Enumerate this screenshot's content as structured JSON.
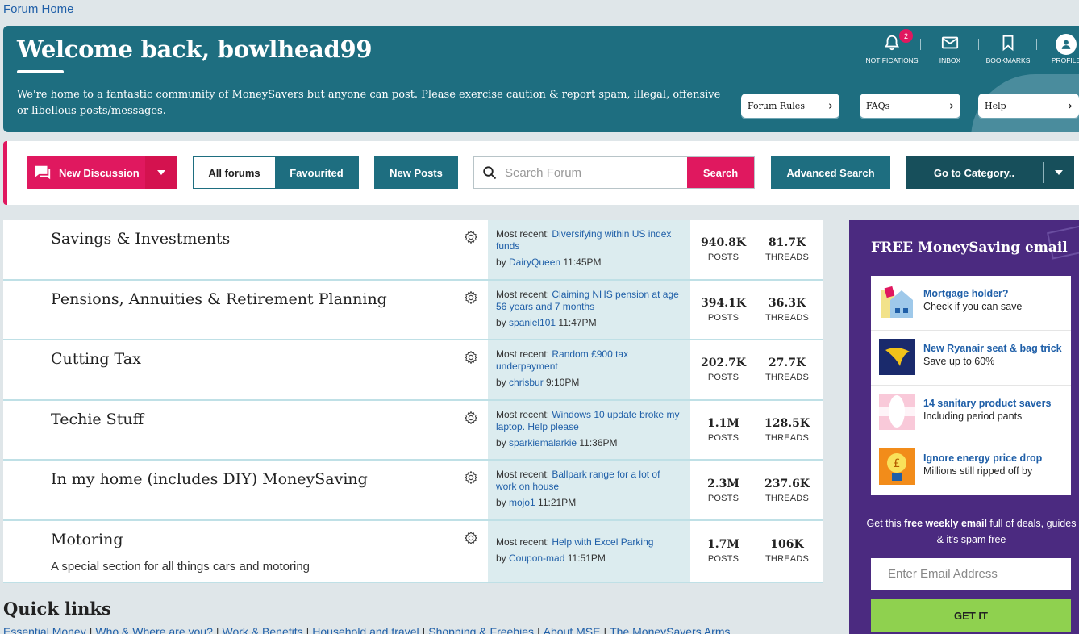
{
  "breadcrumb": "Forum Home",
  "hero": {
    "title": "Welcome back, bowlhead99",
    "intro": "We're home to a fantastic community of MoneySavers but anyone can post. Please exercise caution & report spam, illegal, offensive or libellous posts/messages.",
    "notifications_label": "NOTIFICATIONS",
    "notifications_count": "2",
    "inbox_label": "INBOX",
    "bookmarks_label": "BOOKMARKS",
    "profile_label": "PROFILE",
    "links": [
      "Forum Rules",
      "FAQs",
      "Help"
    ]
  },
  "toolbar": {
    "new_discussion": "New Discussion",
    "all_forums": "All forums",
    "favourited": "Favourited",
    "new_posts": "New Posts",
    "search_placeholder": "Search Forum",
    "search_button": "Search",
    "advanced_search": "Advanced Search",
    "go_to_category": "Go to Category.."
  },
  "forums": [
    {
      "title": "Savings & Investments",
      "desc": "",
      "recent_prefix": "Most recent: ",
      "recent_title": "Diversifying within US index funds",
      "by": "by ",
      "author": "DairyQueen",
      "time": "11:45PM",
      "posts": "940.8K",
      "threads": "81.7K"
    },
    {
      "title": "Pensions, Annuities & Retirement Planning",
      "desc": "",
      "recent_prefix": "Most recent: ",
      "recent_title": "Claiming NHS pension at age 56 years and 7 months",
      "by": "by ",
      "author": "spaniel101",
      "time": "11:47PM",
      "posts": "394.1K",
      "threads": "36.3K"
    },
    {
      "title": "Cutting Tax",
      "desc": "",
      "recent_prefix": "Most recent: ",
      "recent_title": "Random £900 tax underpayment",
      "by": "by ",
      "author": "chrisbur",
      "time": "9:10PM",
      "posts": "202.7K",
      "threads": "27.7K"
    },
    {
      "title": "Techie Stuff",
      "desc": "",
      "recent_prefix": "Most recent: ",
      "recent_title": "Windows 10 update broke my laptop. Help please",
      "by": "by ",
      "author": "sparkiemalarkie",
      "time": "11:36PM",
      "posts": "1.1M",
      "threads": "128.5K"
    },
    {
      "title": "In my home (includes DIY) MoneySaving",
      "desc": "",
      "recent_prefix": "Most recent: ",
      "recent_title": "Ballpark range for a lot of work on house",
      "by": "by ",
      "author": "mojo1",
      "time": "11:21PM",
      "posts": "2.3M",
      "threads": "237.6K"
    },
    {
      "title": "Motoring",
      "desc": "A special section for all things cars and motoring",
      "recent_prefix": "Most recent: ",
      "recent_title": "Help with Excel Parking",
      "by": "by ",
      "author": "Coupon-mad",
      "time": "11:51PM",
      "posts": "1.7M",
      "threads": "106K"
    }
  ],
  "stat_labels": {
    "posts": "POSTS",
    "threads": "THREADS"
  },
  "quick_links": {
    "heading": "Quick links",
    "items": [
      "Essential Money",
      "Who & Where are you?",
      "Work & Benefits",
      "Household and travel",
      "Shopping & Freebies",
      "About MSE",
      "The MoneySavers Arms"
    ],
    "separator": "|"
  },
  "promo": {
    "heading": "FREE MoneySaving email",
    "items": [
      {
        "title": "Mortgage holder?",
        "sub": "Check if you can save",
        "icon": "house-icon"
      },
      {
        "title": "New Ryanair seat & bag trick",
        "sub": "Save up to 60%",
        "icon": "ryanair-icon"
      },
      {
        "title": "14 sanitary product savers",
        "sub": "Including period pants",
        "icon": "sanitary-icon"
      },
      {
        "title": "Ignore energy price drop",
        "sub": "Millions still ripped off by",
        "icon": "lightbulb-icon"
      }
    ],
    "sub_pre": "Get this ",
    "sub_bold": "free weekly email",
    "sub_post": " full of deals, guides & it's spam free",
    "email_placeholder": "Enter Email Address",
    "button": "GET IT"
  },
  "colors": {
    "teal": "#1e6e80",
    "pink": "#e0185f",
    "purple": "#4b2a80",
    "green": "#8fd14f"
  }
}
